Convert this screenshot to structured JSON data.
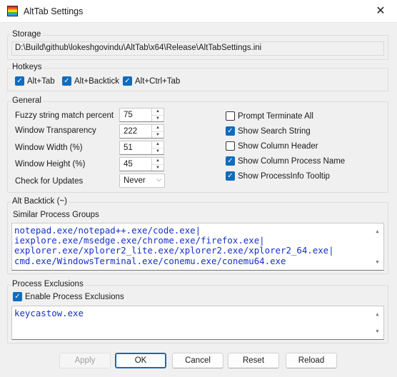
{
  "window": {
    "title": "AltTab Settings"
  },
  "storage": {
    "label": "Storage",
    "path": "D:\\Build\\github\\lokeshgovindu\\AltTab\\x64\\Release\\AltTabSettings.ini"
  },
  "hotkeys": {
    "label": "Hotkeys",
    "items": [
      {
        "label": "Alt+Tab",
        "checked": true
      },
      {
        "label": "Alt+Backtick",
        "checked": true
      },
      {
        "label": "Alt+Ctrl+Tab",
        "checked": true
      }
    ]
  },
  "general": {
    "label": "General",
    "fields": [
      {
        "label": "Fuzzy string match percent",
        "value": "75"
      },
      {
        "label": "Window Transparency",
        "value": "222"
      },
      {
        "label": "Window Width (%)",
        "value": "51"
      },
      {
        "label": "Window Height (%)",
        "value": "45"
      }
    ],
    "updates": {
      "label": "Check for Updates",
      "value": "Never"
    },
    "options": [
      {
        "label": "Prompt Terminate All",
        "checked": false
      },
      {
        "label": "Show Search String",
        "checked": true
      },
      {
        "label": "Show Column Header",
        "checked": false
      },
      {
        "label": "Show Column Process Name",
        "checked": true
      },
      {
        "label": "Show ProcessInfo Tooltip",
        "checked": true
      }
    ]
  },
  "backtick": {
    "label": "Alt Backtick (~)",
    "groups_label": "Similar Process Groups",
    "lines": [
      "notepad.exe/notepad++.exe/code.exe|",
      "iexplore.exe/msedge.exe/chrome.exe/firefox.exe|",
      "explorer.exe/xplorer2_lite.exe/xplorer2.exe/xplorer2_64.exe|",
      "cmd.exe/WindowsTerminal.exe/conemu.exe/conemu64.exe"
    ]
  },
  "exclusions": {
    "label": "Process Exclusions",
    "enable_label": "Enable Process Exclusions",
    "enabled": true,
    "lines": [
      "keycastow.exe"
    ]
  },
  "buttons": {
    "apply": "Apply",
    "ok": "OK",
    "cancel": "Cancel",
    "reset": "Reset",
    "reload": "Reload"
  },
  "colors": {
    "accent": "#0f6cbd",
    "text_blue": "#1630c8"
  }
}
